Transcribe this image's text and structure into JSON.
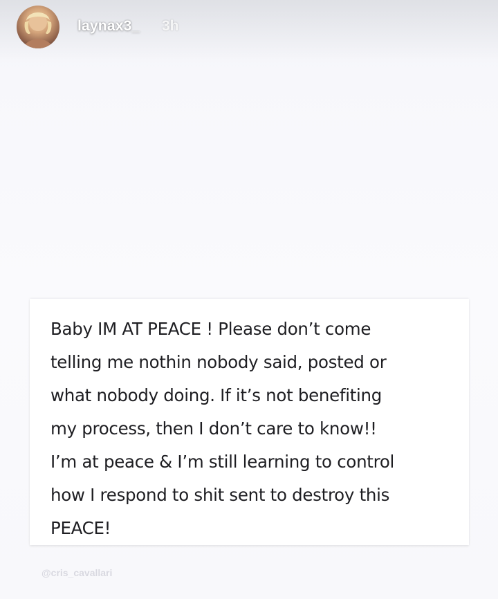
{
  "story": {
    "username": "laynax3_",
    "timestamp": "3h",
    "avatar_icon": "profile-avatar"
  },
  "post": {
    "text": "Baby IM AT PEACE ! Please don’t come\ntelling me nothin nobody said, posted or\nwhat nobody doing. If it’s not benefiting\nmy process, then I don’t care to know!!\nI’m at peace & I’m still learning to control\nhow I respond to shit sent to destroy this\nPEACE!"
  },
  "watermark": {
    "text": "@cris_cavallari"
  },
  "colors": {
    "background": "#f7f7fb",
    "card": "#ffffff",
    "text": "#1e1e22",
    "header_text": "#ffffff"
  }
}
